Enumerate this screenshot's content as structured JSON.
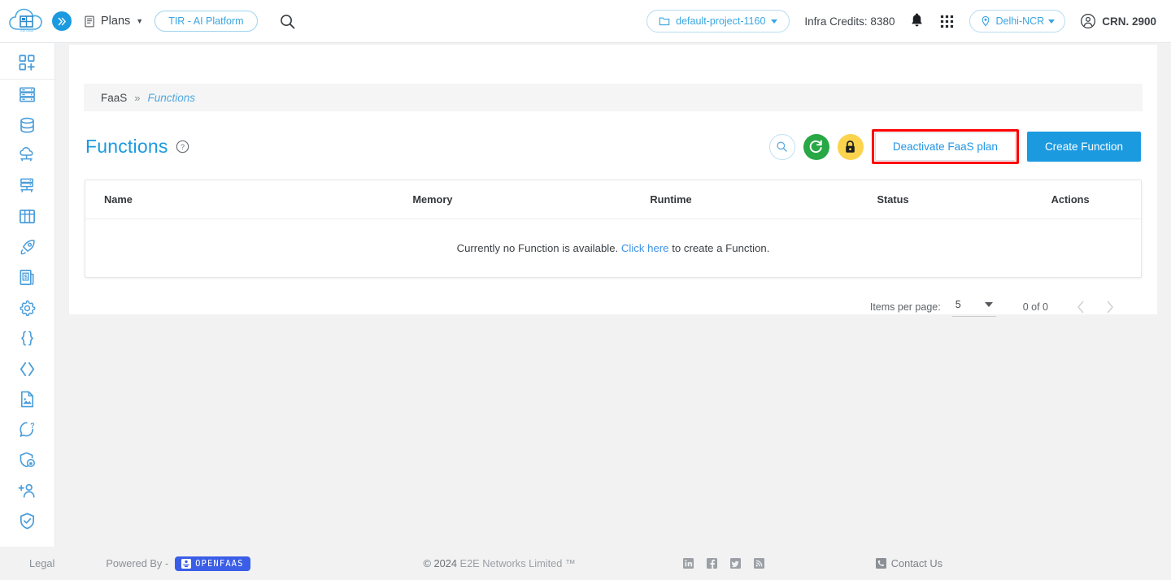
{
  "header": {
    "logo_alt": "e2e-cloud-logo",
    "expand_icon": "double-chevron-right-icon",
    "plans_label": "Plans",
    "tir_pill_label": "TIR - AI Platform",
    "search_icon": "search-icon",
    "project_label": "default-project-1160",
    "project_icon": "folder-icon",
    "credits_label": "Infra Credits: 8380",
    "bell_icon": "notification-bell-icon",
    "apps_icon": "app-grid-icon",
    "region_label": "Delhi-NCR",
    "region_icon": "location-pin-icon",
    "account_label": "CRN. 2900",
    "account_icon": "user-circle-icon"
  },
  "sidebar": {
    "items": [
      {
        "icon": "dashboard-add-icon",
        "label": "Add Resource"
      },
      {
        "icon": "server-icon",
        "label": "Compute Nodes"
      },
      {
        "icon": "database-icon",
        "label": "Databases"
      },
      {
        "icon": "cloud-network-icon",
        "label": "Cloud Network"
      },
      {
        "icon": "server-network-icon",
        "label": "Server Network"
      },
      {
        "icon": "storage-grid-icon",
        "label": "Storage"
      },
      {
        "icon": "rocket-icon",
        "label": "Launch"
      },
      {
        "icon": "billing-icon",
        "label": "Billing"
      },
      {
        "icon": "gear-icon",
        "label": "Settings"
      },
      {
        "icon": "curly-braces-icon",
        "label": "API"
      },
      {
        "icon": "code-brackets-icon",
        "label": "Developers"
      },
      {
        "icon": "document-image-icon",
        "label": "Images"
      },
      {
        "icon": "support-chat-icon",
        "label": "Support"
      },
      {
        "icon": "shield-lock-icon",
        "label": "Security"
      },
      {
        "icon": "add-user-icon",
        "label": "Add User"
      },
      {
        "icon": "shield-check-icon",
        "label": "Compliance"
      }
    ]
  },
  "breadcrumb": {
    "root": "FaaS",
    "separator": "»",
    "current": "Functions"
  },
  "page": {
    "title": "Functions",
    "help_icon": "question-circle-icon"
  },
  "toolbar": {
    "search_icon": "search-icon",
    "refresh_icon": "refresh-icon",
    "lock_icon": "lock-icon",
    "deactivate_label": "Deactivate FaaS plan",
    "create_label": "Create Function",
    "highlight_color": "#ff0000",
    "refresh_color": "#28a745",
    "lock_color": "#fbd34d",
    "primary_color": "#1b9ae0"
  },
  "table": {
    "columns": [
      "Name",
      "Memory",
      "Runtime",
      "Status",
      "Actions"
    ],
    "empty_message_prefix": "Currently no Function is available.",
    "empty_link": "Click here",
    "empty_message_suffix": "to create a Function.",
    "rows": []
  },
  "paginator": {
    "items_per_page_label": "Items per page:",
    "items_per_page_value": "5",
    "range_label": "0 of 0",
    "prev_icon": "chevron-left-icon",
    "next_icon": "chevron-right-icon"
  },
  "footer": {
    "legal": "Legal",
    "powered_by": "Powered By -",
    "openfaas_label": "OPENFAAS",
    "copyright_mark": "© 2024",
    "copyright_company": "E2E Networks Limited ™",
    "social": [
      "linkedin-icon",
      "facebook-icon",
      "twitter-icon",
      "rss-icon"
    ],
    "contact_label": "Contact Us",
    "contact_icon": "phone-icon"
  }
}
